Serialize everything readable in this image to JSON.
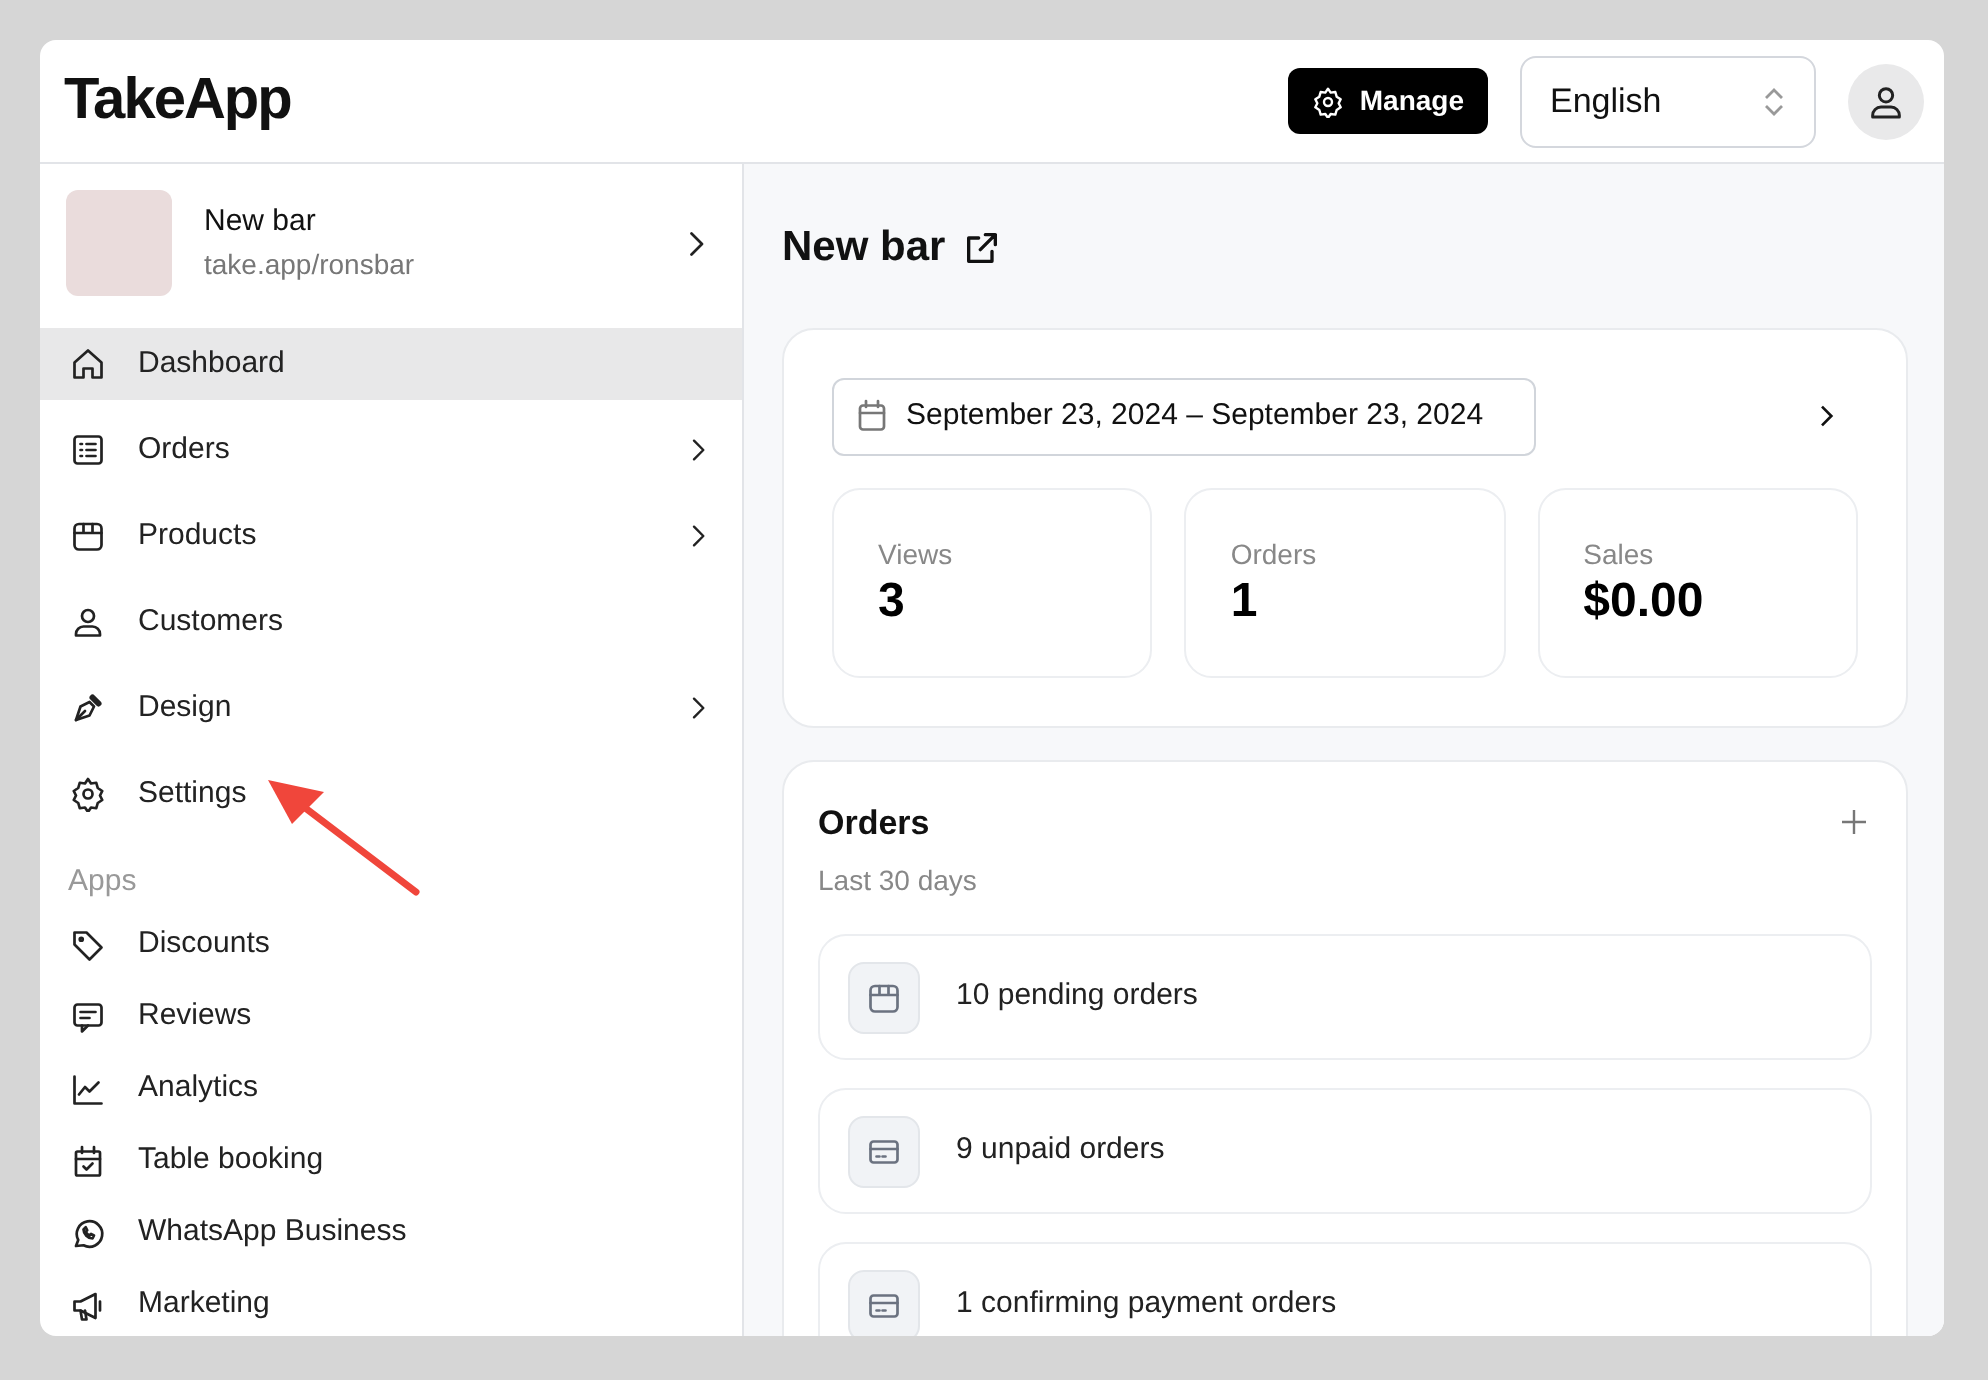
{
  "header": {
    "logo": "TakeApp",
    "manage_button": "Manage",
    "language_select": "English"
  },
  "store": {
    "name": "New bar",
    "url": "take.app/ronsbar"
  },
  "sidebar": {
    "items": [
      {
        "label": "Dashboard",
        "selected": true,
        "expandable": false
      },
      {
        "label": "Orders",
        "selected": false,
        "expandable": true
      },
      {
        "label": "Products",
        "selected": false,
        "expandable": true
      },
      {
        "label": "Customers",
        "selected": false,
        "expandable": false
      },
      {
        "label": "Design",
        "selected": false,
        "expandable": true
      },
      {
        "label": "Settings",
        "selected": false,
        "expandable": false
      }
    ],
    "apps_heading": "Apps",
    "apps": [
      {
        "label": "Discounts",
        "selected": false
      },
      {
        "label": "Reviews",
        "selected": false
      },
      {
        "label": "Analytics",
        "selected": false
      },
      {
        "label": "Table booking",
        "selected": false
      },
      {
        "label": "WhatsApp Business",
        "selected": false
      },
      {
        "label": "Marketing",
        "selected": false
      }
    ]
  },
  "main": {
    "title": "New bar",
    "date_range": "September 23, 2024 – September 23, 2024",
    "stats": [
      {
        "label": "Views",
        "value": "3"
      },
      {
        "label": "Orders",
        "value": "1"
      },
      {
        "label": "Sales",
        "value": "$0.00"
      }
    ],
    "orders": {
      "title": "Orders",
      "subtitle": "Last 30 days",
      "rows": [
        {
          "kind": "box",
          "text": "10 pending orders"
        },
        {
          "kind": "card",
          "text": "9 unpaid orders"
        },
        {
          "kind": "card",
          "text": "1 confirming payment orders"
        }
      ]
    }
  }
}
